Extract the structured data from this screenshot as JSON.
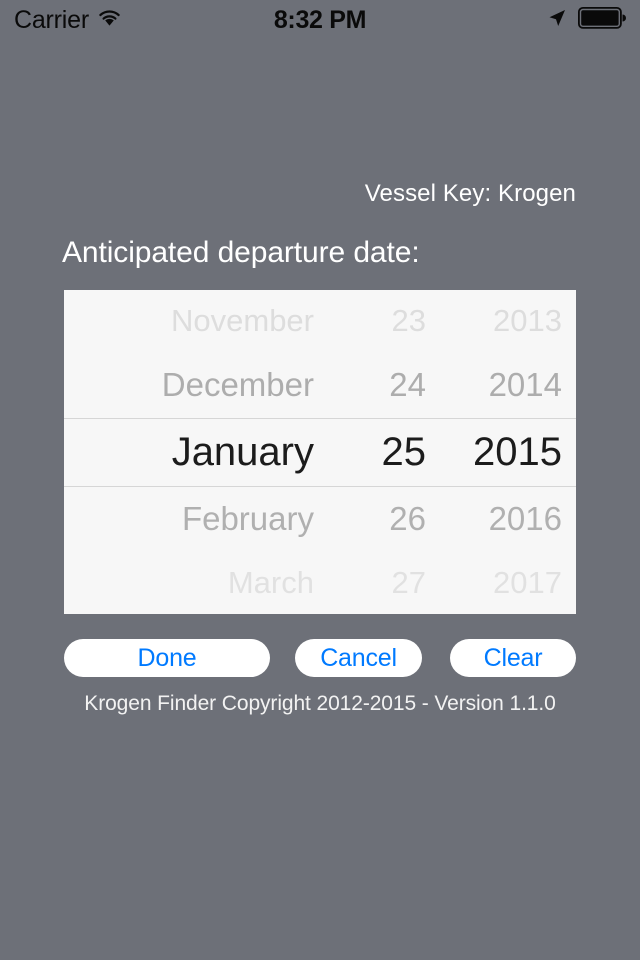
{
  "status_bar": {
    "carrier": "Carrier",
    "time": "8:32 PM",
    "wifi_icon": "wifi-icon",
    "location_icon": "location-arrow-icon",
    "battery_icon": "battery-full-icon"
  },
  "screen": {
    "vessel_key": "Vessel Key: Krogen",
    "prompt": "Anticipated departure date:"
  },
  "picker": {
    "selected_month": "January",
    "selected_day": "25",
    "selected_year": "2015",
    "rows": [
      {
        "month": "November",
        "day": "23",
        "year": "2013"
      },
      {
        "month": "December",
        "day": "24",
        "year": "2014"
      },
      {
        "month": "January",
        "day": "25",
        "year": "2015"
      },
      {
        "month": "February",
        "day": "26",
        "year": "2016"
      },
      {
        "month": "March",
        "day": "27",
        "year": "2017"
      }
    ]
  },
  "buttons": {
    "done": "Done",
    "cancel": "Cancel",
    "clear": "Clear"
  },
  "footer": {
    "copyright": "Krogen Finder Copyright 2012-2015 - Version 1.1.0"
  },
  "colors": {
    "background": "#6d7078",
    "picker_background": "#f7f7f7",
    "button_text": "#007aff",
    "button_background": "#ffffff",
    "text_on_background": "#ffffff"
  }
}
